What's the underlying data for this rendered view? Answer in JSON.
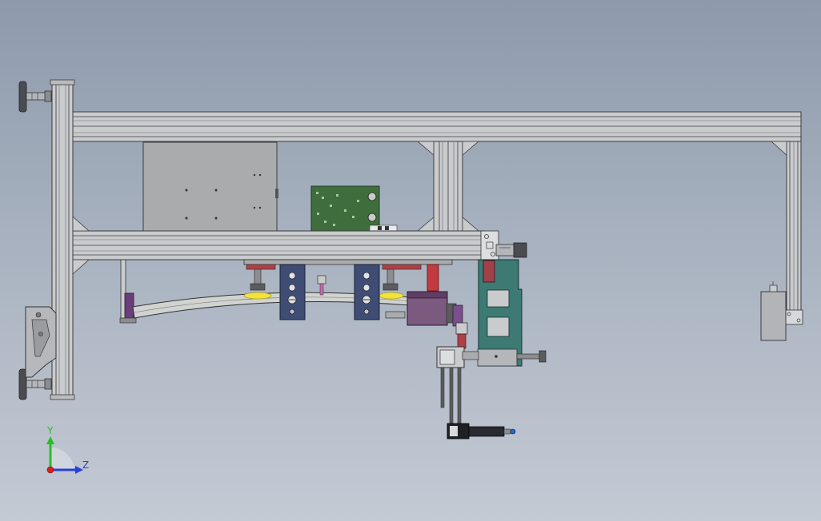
{
  "viewport": {
    "background_top": "#8d9aab",
    "background_bottom": "#c4cad4"
  },
  "triad": {
    "y_label": "Y",
    "z_label": "Z",
    "y_color": "#22c122",
    "z_color": "#2a3fd8",
    "origin_color": "#d82020"
  },
  "colors": {
    "frame": "#c9cbcd",
    "frame_line": "#3a3c40",
    "gray_panel": "#a9abad",
    "pcb_green": "#3f6e3c",
    "teal_bracket": "#3d7a74",
    "navy_plate": "#3f4c73",
    "red_rod": "#c23a3f",
    "purple_block": "#6a3e7a",
    "suction_yellow": "#f2e23a"
  }
}
